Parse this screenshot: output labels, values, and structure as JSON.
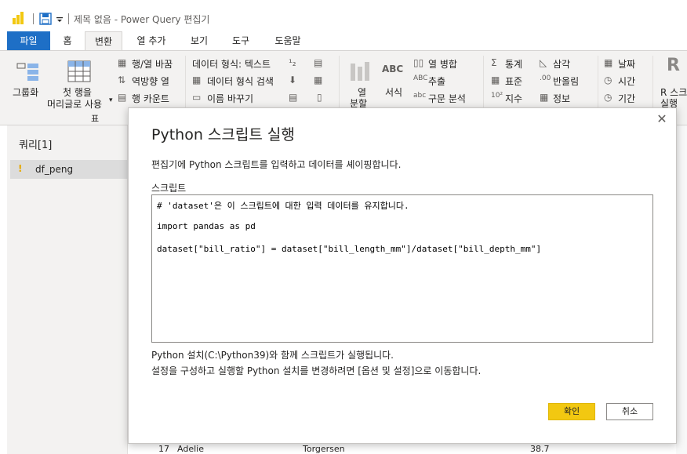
{
  "window": {
    "title": "제목 없음 - Power Query 편집기"
  },
  "ribbon_tabs": [
    {
      "label": "파일"
    },
    {
      "label": "홈"
    },
    {
      "label": "변환"
    },
    {
      "label": "열 추가"
    },
    {
      "label": "보기"
    },
    {
      "label": "도구"
    },
    {
      "label": "도움말"
    }
  ],
  "ribbon": {
    "group_label": "그룹화",
    "first_row_header_l1": "첫 행을",
    "first_row_header_l2": "머리글로 사용",
    "table_group": "표",
    "transpose_rowcol": "행/열 바꿈",
    "reverse_rows": "역방향 열",
    "count_rows": "행 카운트",
    "data_type": "데이터 형식: 텍스트",
    "detect_type": "데이터 형식 검색",
    "rename": "이름 바꾸기",
    "split_col": "열",
    "split_col2": "분할",
    "format": "서식",
    "merge_cols": "열 병합",
    "extract": "추출",
    "parse": "구문 분석",
    "statistics": "통계",
    "standard": "표준",
    "scientific": "지수",
    "trig": "삼각",
    "rounding": "반올림",
    "info": "정보",
    "date": "날짜",
    "time": "시간",
    "duration": "기간",
    "r_script_l1": "R 스크",
    "r_script_l2": "실행"
  },
  "left_pane": {
    "header": "쿼리[1]",
    "queries": [
      {
        "name": "df_peng",
        "warning": "!"
      }
    ]
  },
  "grid_peek": {
    "row_number": "17",
    "species": "Adelie",
    "island": "Torgersen",
    "value": "38.7"
  },
  "dialog": {
    "title": "Python 스크립트 실행",
    "description": "편집기에 Python 스크립트를 입력하고 데이터를 셰이핑합니다.",
    "script_label": "스크립트",
    "script_lines": [
      "# 'dataset'은 이 스크립트에 대한 입력 데이터를 유지합니다.",
      "import pandas as pd",
      "dataset[\"bill_ratio\"] = dataset[\"bill_length_mm\"]/dataset[\"bill_depth_mm\"]"
    ],
    "note_line1": "Python 설치(C:\\Python39)와 함께 스크립트가 실행됩니다.",
    "note_line2": "설정을 구성하고 실행할 Python 설치를 변경하려면 [옵션 및 설정]으로 이동합니다.",
    "ok_label": "확인",
    "cancel_label": "취소",
    "close_glyph": "✕"
  },
  "colors": {
    "accent_yellow": "#f2c811",
    "file_tab_blue": "#1e6fc6"
  }
}
